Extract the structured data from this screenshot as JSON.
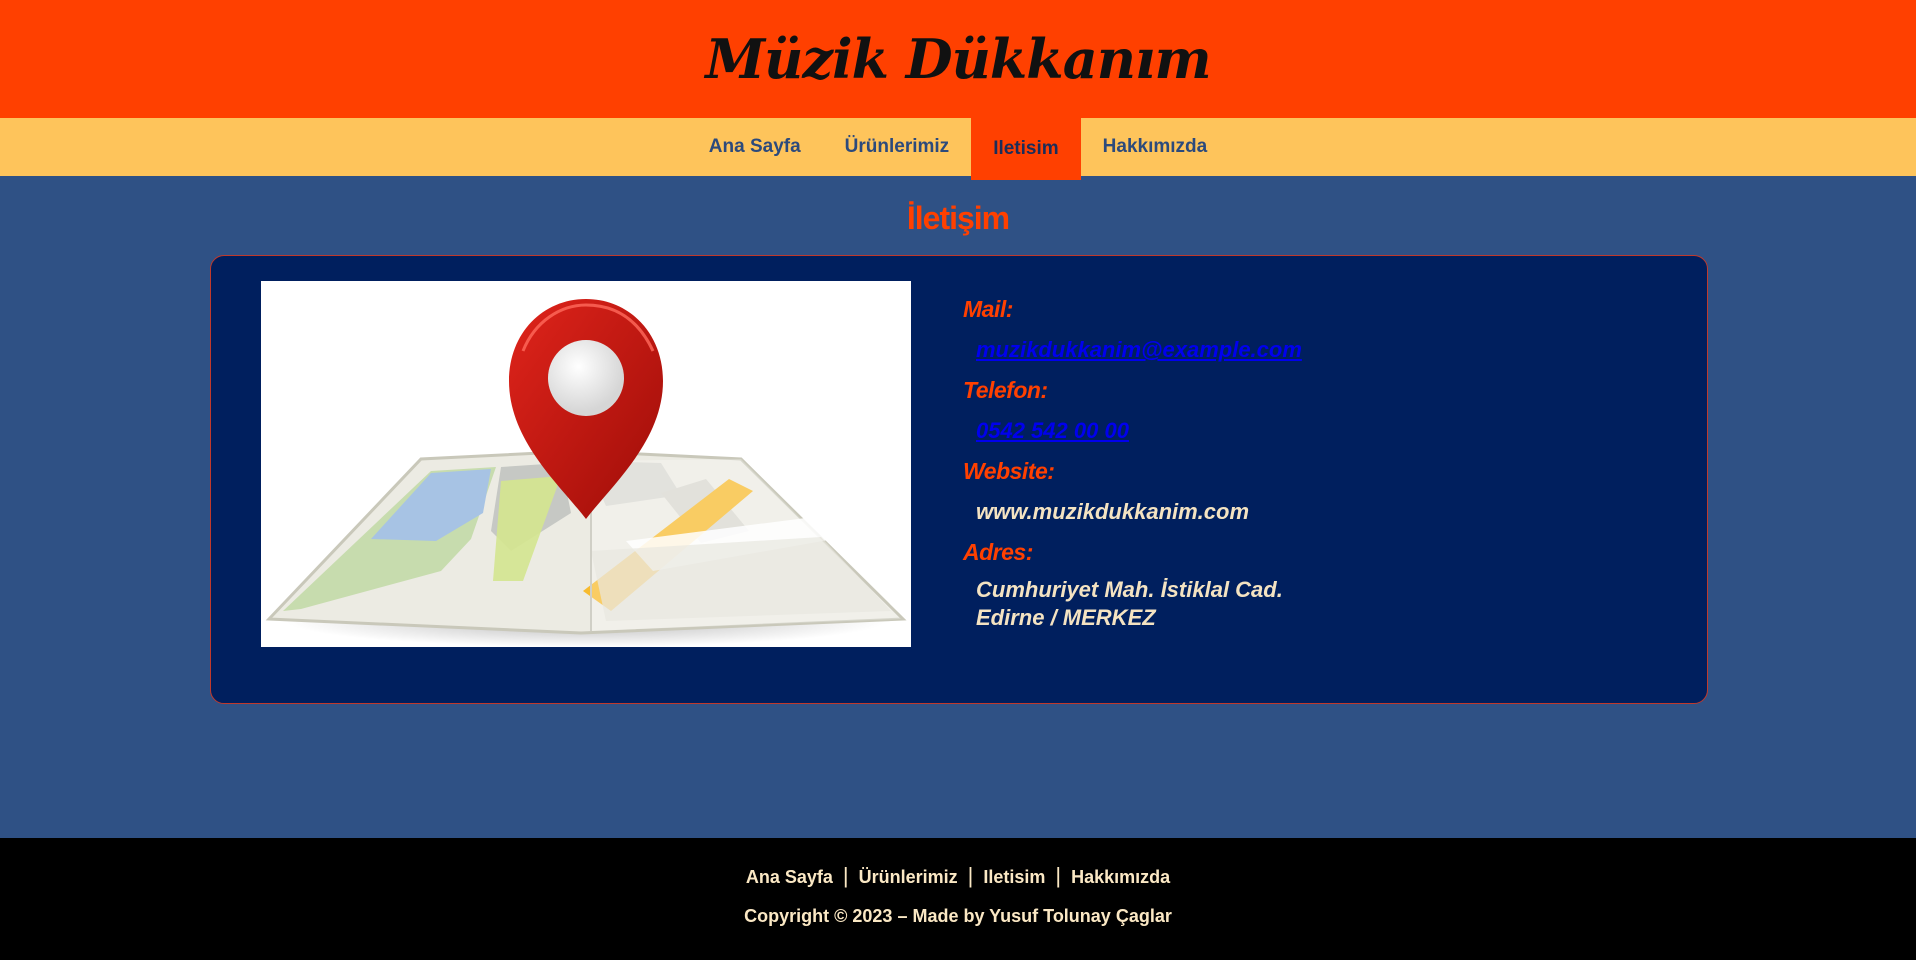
{
  "header": {
    "title": "Müzik Dükkanım"
  },
  "nav": {
    "items": [
      {
        "label": "Ana Sayfa"
      },
      {
        "label": "Ürünlerimiz"
      },
      {
        "label": "Iletisim"
      },
      {
        "label": "Hakkımızda"
      }
    ],
    "active": "Iletisim"
  },
  "page": {
    "heading": "İletişim"
  },
  "contact": {
    "mail_label": "Mail:",
    "mail_value": "muzikdukkanim@example.com",
    "phone_label": "Telefon:",
    "phone_value": "0542 542 00 00",
    "website_label": "Website:",
    "website_value": "www.muzikdukkanim.com",
    "address_label": "Adres:",
    "address_line1": "Cumhuriyet Mah. İstiklal Cad.",
    "address_line2": "Edirne / MERKEZ"
  },
  "map_image": {
    "icon": "map-pin-icon"
  },
  "footer": {
    "links": [
      {
        "label": "Ana Sayfa"
      },
      {
        "label": "Ürünlerimiz"
      },
      {
        "label": "Iletisim"
      },
      {
        "label": "Hakkımızda"
      }
    ],
    "separator": "|",
    "copyright": "Copyright © 2023 – Made by Yusuf Tolunay Çaglar"
  },
  "colors": {
    "header_bg": "#ff4000",
    "nav_bg": "#fec45b",
    "page_bg": "#2f5185",
    "card_bg": "#001f5e",
    "accent": "#ff4000",
    "footer_bg": "#000000"
  }
}
